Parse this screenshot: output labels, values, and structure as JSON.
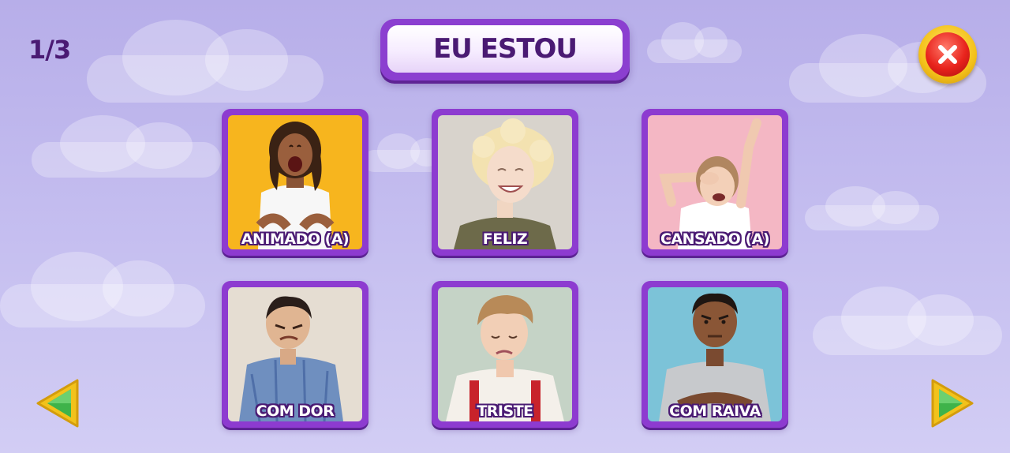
{
  "header": {
    "progress": "1/3",
    "title": "EU ESTOU"
  },
  "cards": [
    {
      "label": "ANIMADO (A)",
      "bg": "#f7b51e"
    },
    {
      "label": "FELIZ",
      "bg": "#d8d3cc"
    },
    {
      "label": "CANSADO (A)",
      "bg": "#f4b7c4"
    },
    {
      "label": "COM DOR",
      "bg": "#e5ddd2"
    },
    {
      "label": "TRISTE",
      "bg": "#c5d3c6"
    },
    {
      "label": "COM RAIVA",
      "bg": "#7cc3d8"
    }
  ],
  "icons": {
    "close": "close-x-icon",
    "prev": "left-arrow-icon",
    "next": "right-arrow-icon"
  },
  "colors": {
    "frame": "#8d3bd0",
    "text_dark": "#4a1a73",
    "close_red": "#e8231c",
    "arrow_green": "#3fb34a",
    "arrow_rim": "#f2c21b"
  }
}
